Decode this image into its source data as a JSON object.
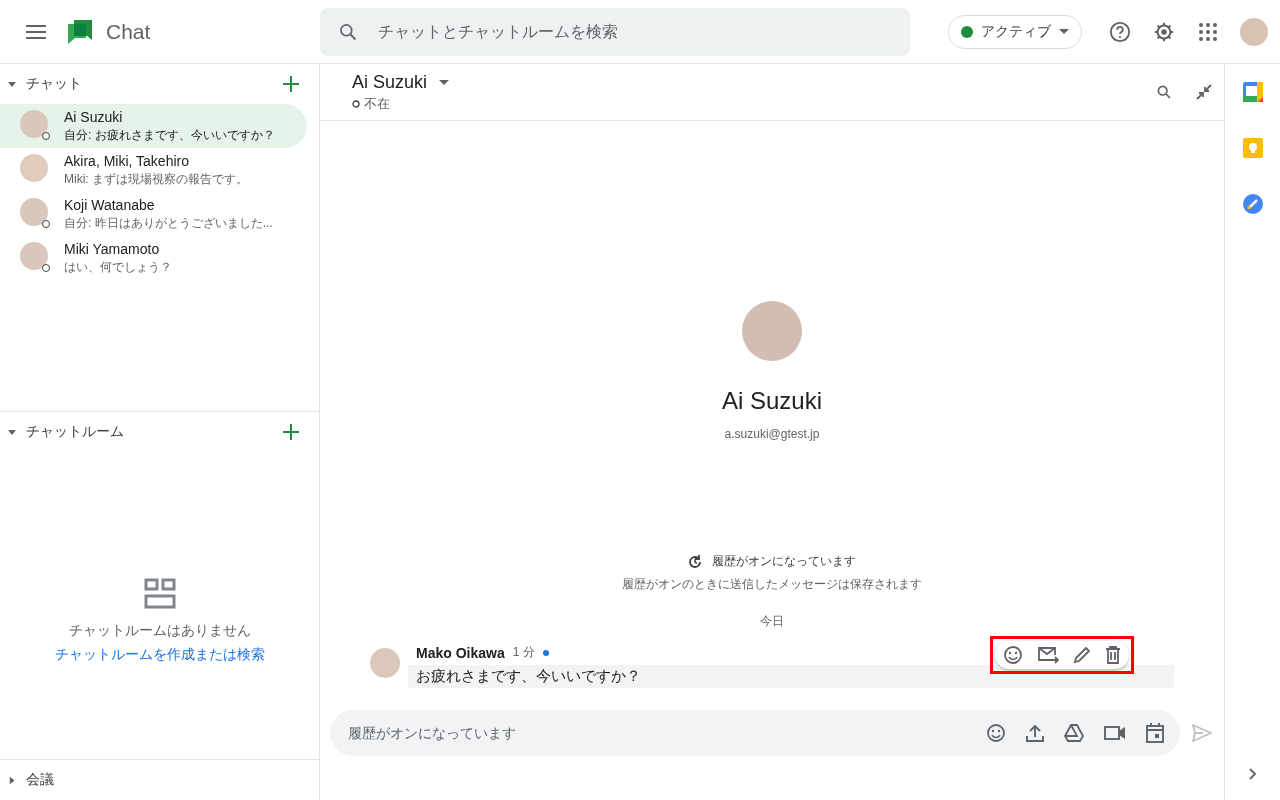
{
  "app": {
    "title": "Chat"
  },
  "search": {
    "placeholder": "チャットとチャットルームを検索"
  },
  "status": {
    "label": "アクティブ",
    "color": "#1e8e3e"
  },
  "chat_section": {
    "title": "チャット",
    "expanded": true,
    "items": [
      {
        "name": "Ai Suzuki",
        "preview": "自分: お疲れさまです、今いいですか？",
        "selected": true,
        "kind": "single"
      },
      {
        "name": "Akira, Miki, Takehiro",
        "preview": "Miki: まずは現場視察の報告です。",
        "selected": false,
        "kind": "group"
      },
      {
        "name": "Koji Watanabe",
        "preview": "自分: 昨日はありがとうございました...",
        "selected": false,
        "kind": "single"
      },
      {
        "name": "Miki Yamamoto",
        "preview": "はい、何でしょう？",
        "selected": false,
        "kind": "single"
      }
    ]
  },
  "room_section": {
    "title": "チャットルーム",
    "expanded": true,
    "empty_text": "チャットルームはありません",
    "empty_link": "チャットルームを作成または検索"
  },
  "meeting_section": {
    "title": "会議",
    "expanded": false
  },
  "conversation": {
    "name": "Ai Suzuki",
    "presence": "不在",
    "profile_name": "Ai Suzuki",
    "email": "a.suzuki@gtest.jp",
    "history_title": "履歴がオンになっています",
    "history_note": "履歴がオンのときに送信したメッセージは保存されます",
    "day": "今日",
    "messages": [
      {
        "sender": "Mako Oikawa",
        "time": "1 分",
        "unread": true,
        "text": "お疲れさまです、今いいですか？",
        "hovered": true
      }
    ]
  },
  "composer": {
    "placeholder": "履歴がオンになっています"
  }
}
